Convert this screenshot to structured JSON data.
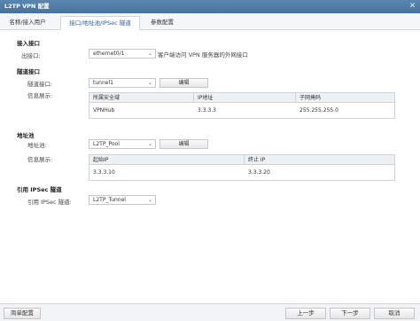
{
  "window": {
    "title": "L2TP VPN 配置"
  },
  "tabs": [
    {
      "label": "名称/接入用户"
    },
    {
      "label": "接口/地址池/IPSec 隧道"
    },
    {
      "label": "参数配置"
    }
  ],
  "access_interface": {
    "section_title": "接入接口",
    "outbound_label": "出接口:",
    "outbound_value": "ethernet0/1",
    "outbound_hint": "客户端访问 VPN 服务器的外网接口"
  },
  "tunnel_interface": {
    "section_title": "隧道接口",
    "tunnel_label": "隧道接口:",
    "tunnel_value": "tunnel1",
    "edit_label": "编辑",
    "info_label": "信息展示:",
    "table": {
      "headers": [
        "所属安全域",
        "IP地址",
        "子网掩码"
      ],
      "rows": [
        [
          "VPNHub",
          "3.3.3.3",
          "255.255.255.0"
        ]
      ]
    }
  },
  "address_pool": {
    "section_title": "地址池",
    "pool_label": "地址池:",
    "pool_value": "L2TP_Pool",
    "edit_label": "编辑",
    "info_label": "信息展示:",
    "table": {
      "headers": [
        "起始IP",
        "终止 IP"
      ],
      "rows": [
        [
          "3.3.3.10",
          "3.3.3.20"
        ]
      ]
    }
  },
  "ipsec": {
    "section_title": "引用 IPSec 隧道",
    "ref_label": "引用 IPSec 隧道:",
    "ref_value": "L2TP_Tunnel"
  },
  "footer": {
    "simple_config": "简单配置",
    "prev": "上一步",
    "next": "下一步",
    "cancel": "取消"
  }
}
